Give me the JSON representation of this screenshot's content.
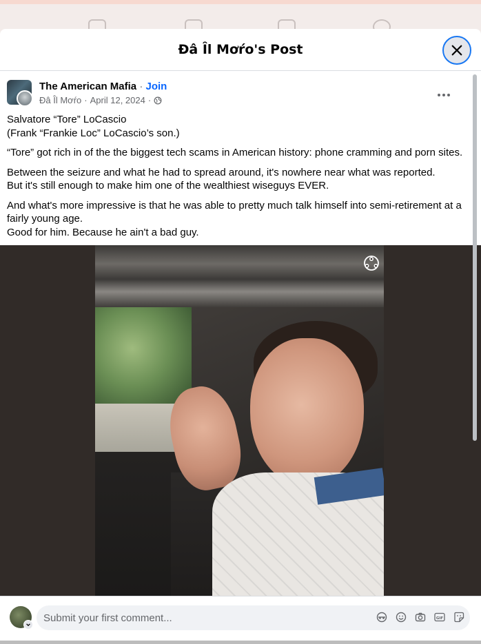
{
  "modal": {
    "title": "Đâ Îl Mơŕo's Post"
  },
  "post": {
    "group_name": "The American Mafia",
    "join_label": "Join",
    "separator": "·",
    "author": "Đâ Îl Mơŕo",
    "date": "April 12, 2024",
    "privacy_icon": "globe-icon",
    "paragraphs": [
      [
        "Salvatore “Tore” LoCascio",
        "(Frank “Frankie Loc” LoCascio’s son.)"
      ],
      [
        "“Tore” got rich in of the the biggest tech scams in American history: phone cramming and porn sites."
      ],
      [
        "Between the seizure and what he had to spread around, it's nowhere near what was reported.",
        "But it's still enough to make him one of the wealthiest wiseguys EVER."
      ],
      [
        "And what's more impressive is that he was able to pretty much talk himself into semi-retirement at a fairly young age.",
        "Good for him. Because he ain't a bad guy."
      ]
    ]
  },
  "comment": {
    "placeholder": "Submit your first comment...",
    "tools": [
      "avatar-sticker-icon",
      "emoji-icon",
      "camera-icon",
      "gif-icon",
      "sticker-icon"
    ]
  },
  "colors": {
    "accent": "#0866ff",
    "close_ring": "#1877f2",
    "photo_background": "#312b28"
  }
}
